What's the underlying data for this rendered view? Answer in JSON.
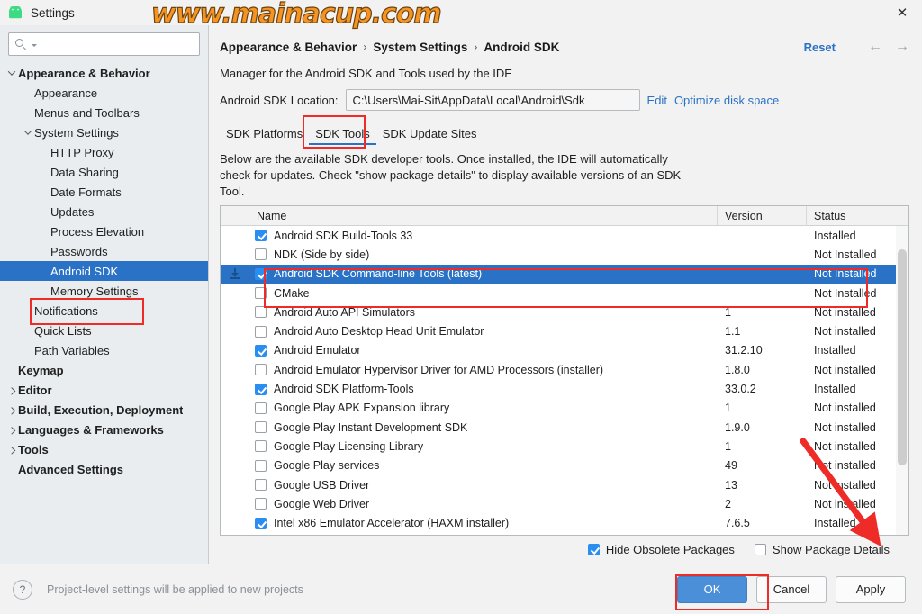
{
  "window": {
    "title": "Settings",
    "icon": "android-icon",
    "close_label": "✕",
    "watermark": "www.mainacup.com"
  },
  "sidebar": {
    "search": {
      "value": "",
      "placeholder": ""
    },
    "items": [
      {
        "label": "Appearance & Behavior",
        "indent": 0,
        "twisty": "down",
        "bold": true,
        "selected": false
      },
      {
        "label": "Appearance",
        "indent": 1,
        "twisty": "none",
        "bold": false,
        "selected": false
      },
      {
        "label": "Menus and Toolbars",
        "indent": 1,
        "twisty": "none",
        "bold": false,
        "selected": false
      },
      {
        "label": "System Settings",
        "indent": 1,
        "twisty": "down",
        "bold": false,
        "selected": false
      },
      {
        "label": "HTTP Proxy",
        "indent": 2,
        "twisty": "none",
        "bold": false,
        "selected": false
      },
      {
        "label": "Data Sharing",
        "indent": 2,
        "twisty": "none",
        "bold": false,
        "selected": false
      },
      {
        "label": "Date Formats",
        "indent": 2,
        "twisty": "none",
        "bold": false,
        "selected": false
      },
      {
        "label": "Updates",
        "indent": 2,
        "twisty": "none",
        "bold": false,
        "selected": false
      },
      {
        "label": "Process Elevation",
        "indent": 2,
        "twisty": "none",
        "bold": false,
        "selected": false
      },
      {
        "label": "Passwords",
        "indent": 2,
        "twisty": "none",
        "bold": false,
        "selected": false
      },
      {
        "label": "Android SDK",
        "indent": 2,
        "twisty": "none",
        "bold": false,
        "selected": true
      },
      {
        "label": "Memory Settings",
        "indent": 2,
        "twisty": "none",
        "bold": false,
        "selected": false
      },
      {
        "label": "Notifications",
        "indent": 1,
        "twisty": "none",
        "bold": false,
        "selected": false
      },
      {
        "label": "Quick Lists",
        "indent": 1,
        "twisty": "none",
        "bold": false,
        "selected": false
      },
      {
        "label": "Path Variables",
        "indent": 1,
        "twisty": "none",
        "bold": false,
        "selected": false
      },
      {
        "label": "Keymap",
        "indent": 0,
        "twisty": "none",
        "bold": true,
        "selected": false
      },
      {
        "label": "Editor",
        "indent": 0,
        "twisty": "right",
        "bold": true,
        "selected": false
      },
      {
        "label": "Build, Execution, Deployment",
        "indent": 0,
        "twisty": "right",
        "bold": true,
        "selected": false
      },
      {
        "label": "Languages & Frameworks",
        "indent": 0,
        "twisty": "right",
        "bold": true,
        "selected": false
      },
      {
        "label": "Tools",
        "indent": 0,
        "twisty": "right",
        "bold": true,
        "selected": false
      },
      {
        "label": "Advanced Settings",
        "indent": 0,
        "twisty": "none",
        "bold": true,
        "selected": false
      }
    ]
  },
  "header": {
    "breadcrumb": [
      "Appearance & Behavior",
      "System Settings",
      "Android SDK"
    ],
    "separator": "›",
    "reset_label": "Reset",
    "back_arrow": "←",
    "forward_arrow": "→"
  },
  "main": {
    "subtitle": "Manager for the Android SDK and Tools used by the IDE",
    "sdk_location_label": "Android SDK Location:",
    "sdk_location_value": "C:\\Users\\Mai-Sit\\AppData\\Local\\Android\\Sdk",
    "edit_link": "Edit",
    "optimize_link": "Optimize disk space",
    "tabs": [
      {
        "label": "SDK Platforms",
        "active": false
      },
      {
        "label": "SDK Tools",
        "active": true
      },
      {
        "label": "SDK Update Sites",
        "active": false
      }
    ],
    "description": "Below are the available SDK developer tools. Once installed, the IDE will automatically check for updates. Check \"show package details\" to display available versions of an SDK Tool.",
    "table": {
      "columns": [
        "Name",
        "Version",
        "Status"
      ],
      "rows": [
        {
          "name": "Android SDK Build-Tools 33",
          "version": "",
          "status": "Installed",
          "checked": true,
          "selected": false,
          "gutter": ""
        },
        {
          "name": "NDK (Side by side)",
          "version": "",
          "status": "Not Installed",
          "checked": false,
          "selected": false,
          "gutter": ""
        },
        {
          "name": "Android SDK Command-line Tools (latest)",
          "version": "",
          "status": "Not Installed",
          "checked": true,
          "selected": true,
          "gutter": "download-icon"
        },
        {
          "name": "CMake",
          "version": "",
          "status": "Not Installed",
          "checked": false,
          "selected": false,
          "gutter": ""
        },
        {
          "name": "Android Auto API Simulators",
          "version": "1",
          "status": "Not installed",
          "checked": false,
          "selected": false,
          "gutter": ""
        },
        {
          "name": "Android Auto Desktop Head Unit Emulator",
          "version": "1.1",
          "status": "Not installed",
          "checked": false,
          "selected": false,
          "gutter": ""
        },
        {
          "name": "Android Emulator",
          "version": "31.2.10",
          "status": "Installed",
          "checked": true,
          "selected": false,
          "gutter": ""
        },
        {
          "name": "Android Emulator Hypervisor Driver for AMD Processors (installer)",
          "version": "1.8.0",
          "status": "Not installed",
          "checked": false,
          "selected": false,
          "gutter": ""
        },
        {
          "name": "Android SDK Platform-Tools",
          "version": "33.0.2",
          "status": "Installed",
          "checked": true,
          "selected": false,
          "gutter": ""
        },
        {
          "name": "Google Play APK Expansion library",
          "version": "1",
          "status": "Not installed",
          "checked": false,
          "selected": false,
          "gutter": ""
        },
        {
          "name": "Google Play Instant Development SDK",
          "version": "1.9.0",
          "status": "Not installed",
          "checked": false,
          "selected": false,
          "gutter": ""
        },
        {
          "name": "Google Play Licensing Library",
          "version": "1",
          "status": "Not installed",
          "checked": false,
          "selected": false,
          "gutter": ""
        },
        {
          "name": "Google Play services",
          "version": "49",
          "status": "Not installed",
          "checked": false,
          "selected": false,
          "gutter": ""
        },
        {
          "name": "Google USB Driver",
          "version": "13",
          "status": "Not installed",
          "checked": false,
          "selected": false,
          "gutter": ""
        },
        {
          "name": "Google Web Driver",
          "version": "2",
          "status": "Not installed",
          "checked": false,
          "selected": false,
          "gutter": ""
        },
        {
          "name": "Intel x86 Emulator Accelerator (HAXM installer)",
          "version": "7.6.5",
          "status": "Installed",
          "checked": true,
          "selected": false,
          "gutter": ""
        }
      ]
    },
    "options": [
      {
        "label": "Hide Obsolete Packages",
        "checked": true
      },
      {
        "label": "Show Package Details",
        "checked": false
      }
    ]
  },
  "footer": {
    "help_glyph": "?",
    "note": "Project-level settings will be applied to new projects",
    "buttons": [
      {
        "label": "OK",
        "primary": true
      },
      {
        "label": "Cancel",
        "primary": false
      },
      {
        "label": "Apply",
        "primary": false
      }
    ]
  },
  "colors": {
    "accent": "#2a72c6",
    "selection": "#2a72c6",
    "annotation": "#ee2b26",
    "watermark": "#F59323",
    "checkbox": "#2a8ef0"
  }
}
